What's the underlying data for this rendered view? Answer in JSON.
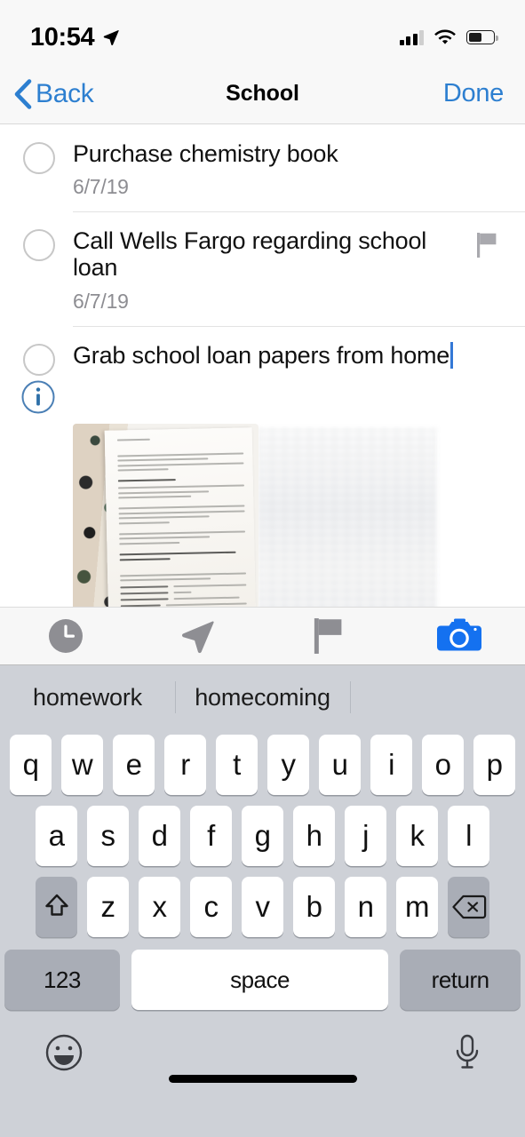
{
  "status_bar": {
    "time": "10:54",
    "location_icon": "location-arrow-icon",
    "signal_icon": "cellular-signal-icon",
    "wifi_icon": "wifi-icon",
    "battery_icon": "battery-icon",
    "battery_level_pct": 52
  },
  "nav_bar": {
    "back_label": "Back",
    "title": "School",
    "done_label": "Done",
    "tint_color": "#2d7fd0"
  },
  "reminders": [
    {
      "title": "Purchase chemistry book",
      "date": "6/7/19",
      "completed": false,
      "flagged": false,
      "has_info": false,
      "editing": false
    },
    {
      "title": "Call Wells Fargo regarding school loan",
      "date": "6/7/19",
      "completed": false,
      "flagged": true,
      "has_info": false,
      "editing": false
    },
    {
      "title": "Grab school loan papers from home",
      "date": "",
      "completed": false,
      "flagged": false,
      "has_info": true,
      "editing": true,
      "attachment": "photo-of-printed-document-on-terrazzo-surface"
    }
  ],
  "accessory_toolbar": {
    "buttons": [
      {
        "name": "remind-me-time-button",
        "icon": "clock-icon",
        "color": "#8e8e93",
        "active": false
      },
      {
        "name": "remind-me-location-button",
        "icon": "location-arrow-icon",
        "color": "#8e8e93",
        "active": false
      },
      {
        "name": "flag-button",
        "icon": "flag-icon",
        "color": "#8e8e93",
        "active": false
      },
      {
        "name": "camera-attachment-button",
        "icon": "camera-icon",
        "color": "#1471f0",
        "active": true
      }
    ]
  },
  "keyboard": {
    "predictions": [
      "homework",
      "homecoming"
    ],
    "row1": [
      "q",
      "w",
      "e",
      "r",
      "t",
      "y",
      "u",
      "i",
      "o",
      "p"
    ],
    "row2": [
      "a",
      "s",
      "d",
      "f",
      "g",
      "h",
      "j",
      "k",
      "l"
    ],
    "row3": [
      "z",
      "x",
      "c",
      "v",
      "b",
      "n",
      "m"
    ],
    "shift_icon": "shift-arrow-icon",
    "delete_icon": "backspace-delete-icon",
    "numbers_label": "123",
    "space_label": "space",
    "return_label": "return",
    "emoji_icon": "emoji-smiley-icon",
    "dictation_icon": "microphone-icon",
    "background_color": "#ced1d7",
    "key_color": "#ffffff",
    "special_key_color": "#a9adb6"
  }
}
